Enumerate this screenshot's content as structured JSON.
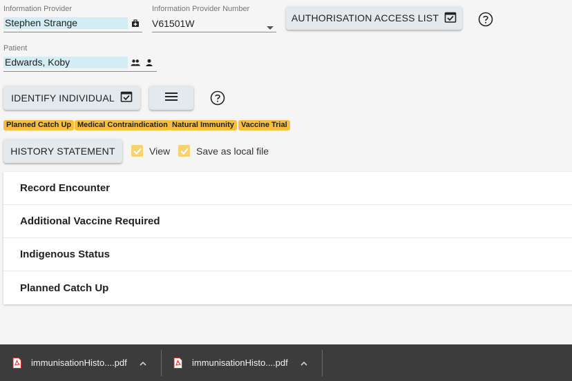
{
  "information_provider": {
    "label": "Information Provider",
    "value": "Stephen Strange",
    "icon": "medical-bag-icon"
  },
  "provider_number": {
    "label": "Information Provider Number",
    "value": "V61501W"
  },
  "auth_button": {
    "label": "AUTHORISATION ACCESS LIST",
    "icon": "calendar-check-icon"
  },
  "patient": {
    "label": "Patient",
    "value": "Edwards, Koby"
  },
  "identify_button": {
    "label": "IDENTIFY INDIVIDUAL",
    "icon": "calendar-check-icon"
  },
  "chips": [
    "Planned Catch Up",
    "Medical Contraindication",
    "Natural Immunity",
    "Vaccine Trial"
  ],
  "history": {
    "button_label": "HISTORY STATEMENT",
    "view_label": "View",
    "view_checked": true,
    "save_label": "Save as local file",
    "save_checked": true
  },
  "panels": [
    "Record Encounter",
    "Additional Vaccine Required",
    "Indigenous Status",
    "Planned Catch Up"
  ],
  "downloads": [
    {
      "filename": "immunisationHisto....pdf",
      "icon": "pdf-file-icon"
    },
    {
      "filename": "immunisationHisto....pdf",
      "icon": "pdf-file-icon"
    }
  ],
  "colors": {
    "chip": "#f6be3c",
    "checkbox": "#f7d26f",
    "button_bg": "#e3e9ec",
    "download_bar": "#3c3c3c"
  }
}
